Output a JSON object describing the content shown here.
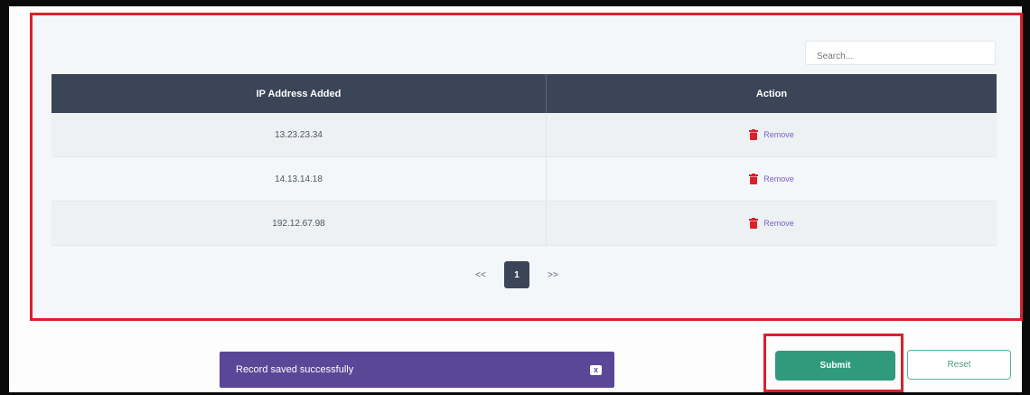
{
  "search": {
    "placeholder": "Search..."
  },
  "table": {
    "columns": [
      "IP Address Added",
      "Action"
    ],
    "rows": [
      {
        "ip": "13.23.23.34",
        "action": "Remove"
      },
      {
        "ip": "14.13.14.18",
        "action": "Remove"
      },
      {
        "ip": "192.12.67.98",
        "action": "Remove"
      }
    ]
  },
  "pagination": {
    "prev": "<<",
    "current": "1",
    "next": ">>"
  },
  "toast": {
    "message": "Record saved successfully",
    "close": "x"
  },
  "actions": {
    "submit": "Submit",
    "reset": "Reset"
  },
  "icons": {
    "row_action": "trash-icon"
  },
  "colors": {
    "highlight": "#d9212b",
    "table_header": "#3a4557",
    "remove_icon": "#d9212b",
    "remove_text": "#7c5fc4",
    "toast": "#5b4797",
    "submit": "#2f9a7c"
  }
}
